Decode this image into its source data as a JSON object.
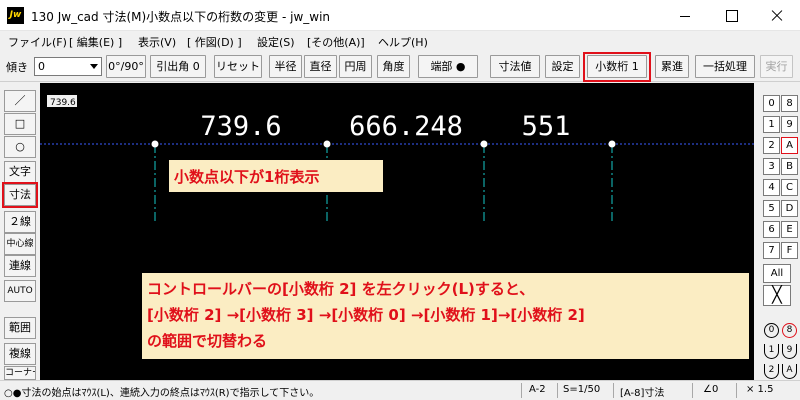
{
  "window": {
    "app_icon": "Jw",
    "title": "130 Jw_cad 寸法(M)小数点以下の桁数の変更 - jw_win"
  },
  "menu": [
    "ファイル(F)",
    "[ 編集(E) ]",
    "表示(V)",
    "[ 作図(D) ]",
    "設定(S)",
    "[その他(A)]",
    "ヘルプ(H)"
  ],
  "control_bar": {
    "tilt_label": "傾き",
    "tilt_value": "0",
    "buttons": [
      "0°/90°",
      "引出角 0",
      "リセット",
      "半径",
      "直径",
      "円周",
      "角度",
      "端部 ●",
      "寸法値",
      "設定",
      "小数桁 1",
      "累進",
      "一括処理",
      "実行"
    ]
  },
  "left_tools": [
    "／",
    "□",
    "○",
    "文字",
    "寸法",
    "２線",
    "中心線",
    "連線",
    "AUTO",
    "範囲",
    "複線",
    "コーナー"
  ],
  "right_tools": {
    "layer_rows": [
      [
        "0",
        "8"
      ],
      [
        "1",
        "9"
      ],
      [
        "2",
        "A"
      ],
      [
        "3",
        "B"
      ],
      [
        "4",
        "C"
      ],
      [
        "5",
        "D"
      ],
      [
        "6",
        "E"
      ],
      [
        "7",
        "F"
      ]
    ],
    "all_label": "All",
    "x_label": "╳",
    "group_rows": [
      [
        "0",
        "8"
      ],
      [
        "1",
        "9"
      ],
      [
        "2",
        "A"
      ]
    ]
  },
  "canvas": {
    "corner_label": "739.6",
    "dimension_values": [
      "739.6",
      "666.248",
      "551"
    ],
    "annotation_1": "小数点以下が1桁表示",
    "annotation_2_lines": [
      "コントロールバーの[小数桁 2] を左クリック(L)すると、",
      "[小数桁 2] →[小数桁 3] →[小数桁 0] →[小数桁 1]→[小数桁 2]",
      "の範囲で切替わる"
    ]
  },
  "statusbar": {
    "message": "○●寸法の始点はﾏｳｽ(L)、連続入力の終点はﾏｳｽ(R)で指示して下さい。",
    "paper": "A-2",
    "scale": "S=1/50",
    "layer": "[A-8]寸法",
    "angle": "∠0",
    "factor": "× 1.5"
  },
  "colors": {
    "highlight": "#e0101a",
    "canvas_bg": "#000000",
    "annotation_bg": "#fbedc3",
    "dim_line": "#3a5cff",
    "extension_line": "#16c7c7"
  }
}
